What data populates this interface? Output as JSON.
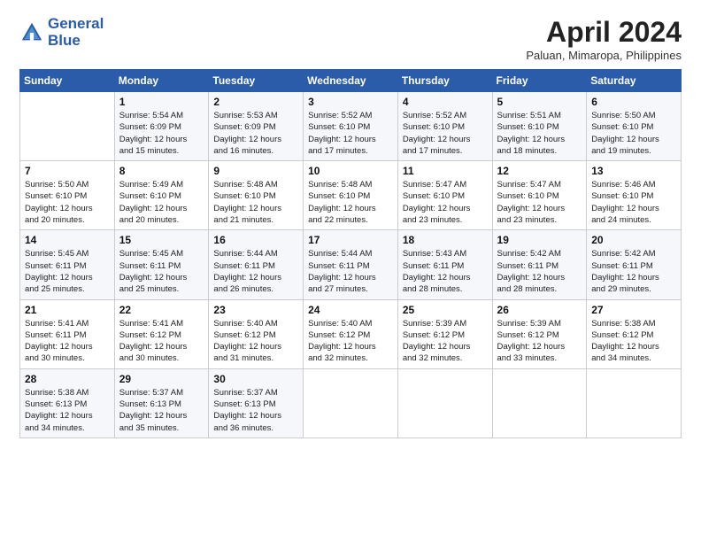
{
  "logo": {
    "line1": "General",
    "line2": "Blue"
  },
  "title": "April 2024",
  "location": "Paluan, Mimaropa, Philippines",
  "days_of_week": [
    "Sunday",
    "Monday",
    "Tuesday",
    "Wednesday",
    "Thursday",
    "Friday",
    "Saturday"
  ],
  "weeks": [
    [
      {
        "day": "",
        "info": ""
      },
      {
        "day": "1",
        "info": "Sunrise: 5:54 AM\nSunset: 6:09 PM\nDaylight: 12 hours\nand 15 minutes."
      },
      {
        "day": "2",
        "info": "Sunrise: 5:53 AM\nSunset: 6:09 PM\nDaylight: 12 hours\nand 16 minutes."
      },
      {
        "day": "3",
        "info": "Sunrise: 5:52 AM\nSunset: 6:10 PM\nDaylight: 12 hours\nand 17 minutes."
      },
      {
        "day": "4",
        "info": "Sunrise: 5:52 AM\nSunset: 6:10 PM\nDaylight: 12 hours\nand 17 minutes."
      },
      {
        "day": "5",
        "info": "Sunrise: 5:51 AM\nSunset: 6:10 PM\nDaylight: 12 hours\nand 18 minutes."
      },
      {
        "day": "6",
        "info": "Sunrise: 5:50 AM\nSunset: 6:10 PM\nDaylight: 12 hours\nand 19 minutes."
      }
    ],
    [
      {
        "day": "7",
        "info": "Sunrise: 5:50 AM\nSunset: 6:10 PM\nDaylight: 12 hours\nand 20 minutes."
      },
      {
        "day": "8",
        "info": "Sunrise: 5:49 AM\nSunset: 6:10 PM\nDaylight: 12 hours\nand 20 minutes."
      },
      {
        "day": "9",
        "info": "Sunrise: 5:48 AM\nSunset: 6:10 PM\nDaylight: 12 hours\nand 21 minutes."
      },
      {
        "day": "10",
        "info": "Sunrise: 5:48 AM\nSunset: 6:10 PM\nDaylight: 12 hours\nand 22 minutes."
      },
      {
        "day": "11",
        "info": "Sunrise: 5:47 AM\nSunset: 6:10 PM\nDaylight: 12 hours\nand 23 minutes."
      },
      {
        "day": "12",
        "info": "Sunrise: 5:47 AM\nSunset: 6:10 PM\nDaylight: 12 hours\nand 23 minutes."
      },
      {
        "day": "13",
        "info": "Sunrise: 5:46 AM\nSunset: 6:10 PM\nDaylight: 12 hours\nand 24 minutes."
      }
    ],
    [
      {
        "day": "14",
        "info": "Sunrise: 5:45 AM\nSunset: 6:11 PM\nDaylight: 12 hours\nand 25 minutes."
      },
      {
        "day": "15",
        "info": "Sunrise: 5:45 AM\nSunset: 6:11 PM\nDaylight: 12 hours\nand 25 minutes."
      },
      {
        "day": "16",
        "info": "Sunrise: 5:44 AM\nSunset: 6:11 PM\nDaylight: 12 hours\nand 26 minutes."
      },
      {
        "day": "17",
        "info": "Sunrise: 5:44 AM\nSunset: 6:11 PM\nDaylight: 12 hours\nand 27 minutes."
      },
      {
        "day": "18",
        "info": "Sunrise: 5:43 AM\nSunset: 6:11 PM\nDaylight: 12 hours\nand 28 minutes."
      },
      {
        "day": "19",
        "info": "Sunrise: 5:42 AM\nSunset: 6:11 PM\nDaylight: 12 hours\nand 28 minutes."
      },
      {
        "day": "20",
        "info": "Sunrise: 5:42 AM\nSunset: 6:11 PM\nDaylight: 12 hours\nand 29 minutes."
      }
    ],
    [
      {
        "day": "21",
        "info": "Sunrise: 5:41 AM\nSunset: 6:11 PM\nDaylight: 12 hours\nand 30 minutes."
      },
      {
        "day": "22",
        "info": "Sunrise: 5:41 AM\nSunset: 6:12 PM\nDaylight: 12 hours\nand 30 minutes."
      },
      {
        "day": "23",
        "info": "Sunrise: 5:40 AM\nSunset: 6:12 PM\nDaylight: 12 hours\nand 31 minutes."
      },
      {
        "day": "24",
        "info": "Sunrise: 5:40 AM\nSunset: 6:12 PM\nDaylight: 12 hours\nand 32 minutes."
      },
      {
        "day": "25",
        "info": "Sunrise: 5:39 AM\nSunset: 6:12 PM\nDaylight: 12 hours\nand 32 minutes."
      },
      {
        "day": "26",
        "info": "Sunrise: 5:39 AM\nSunset: 6:12 PM\nDaylight: 12 hours\nand 33 minutes."
      },
      {
        "day": "27",
        "info": "Sunrise: 5:38 AM\nSunset: 6:12 PM\nDaylight: 12 hours\nand 34 minutes."
      }
    ],
    [
      {
        "day": "28",
        "info": "Sunrise: 5:38 AM\nSunset: 6:13 PM\nDaylight: 12 hours\nand 34 minutes."
      },
      {
        "day": "29",
        "info": "Sunrise: 5:37 AM\nSunset: 6:13 PM\nDaylight: 12 hours\nand 35 minutes."
      },
      {
        "day": "30",
        "info": "Sunrise: 5:37 AM\nSunset: 6:13 PM\nDaylight: 12 hours\nand 36 minutes."
      },
      {
        "day": "",
        "info": ""
      },
      {
        "day": "",
        "info": ""
      },
      {
        "day": "",
        "info": ""
      },
      {
        "day": "",
        "info": ""
      }
    ]
  ]
}
